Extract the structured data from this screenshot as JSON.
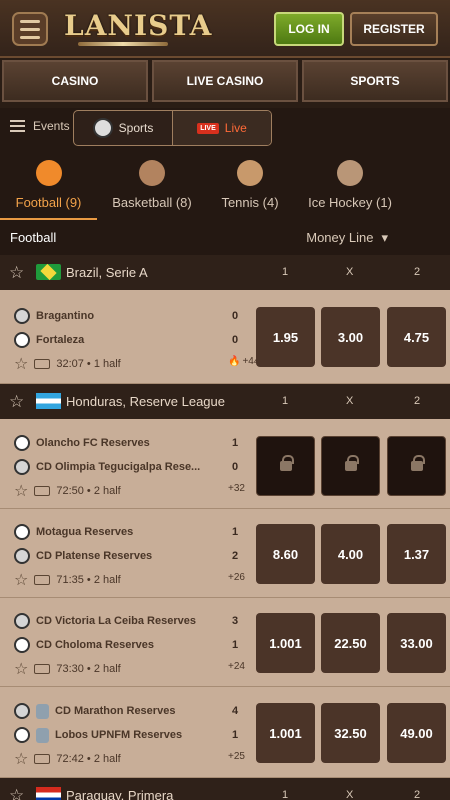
{
  "header": {
    "login_label": "LOG IN",
    "register_label": "REGISTER",
    "logo_text": "LANISTA"
  },
  "nav": {
    "tabs": [
      "CASINO",
      "LIVE CASINO",
      "SPORTS"
    ]
  },
  "subbar": {
    "events_label": "Events",
    "sports_label": "Sports",
    "live_label": "Live",
    "live_badge": "LIVE"
  },
  "sports": [
    {
      "label": "Football (9)",
      "icon": "football-icon"
    },
    {
      "label": "Basketball (8)",
      "icon": "basketball-icon"
    },
    {
      "label": "Tennis (4)",
      "icon": "tennis-icon"
    },
    {
      "label": "Ice Hockey (1)",
      "icon": "ice-hockey-icon"
    }
  ],
  "list": {
    "title": "Football",
    "market": "Money Line"
  },
  "leagues": [
    {
      "name": "Brazil, Serie A",
      "h1": "1",
      "hx": "X",
      "h2": "2"
    },
    {
      "name": "Honduras, Reserve League",
      "h1": "1",
      "hx": "X",
      "h2": "2"
    },
    {
      "name": "Paraguay, Primera",
      "h1": "1",
      "hx": "X",
      "h2": "2"
    }
  ],
  "matches": [
    {
      "team1": "Bragantino",
      "score1": "0",
      "team2": "Fortaleza",
      "score2": "0",
      "time": "32:07 • 1 half",
      "extra": "+442",
      "odds": [
        "1.95",
        "3.00",
        "4.75"
      ]
    },
    {
      "team1": "Olancho FC Reserves",
      "score1": "1",
      "team2": "CD Olimpia Tegucigalpa Rese...",
      "score2": "0",
      "time": "72:50 • 2 half",
      "extra": "+32",
      "odds": [
        "",
        "",
        ""
      ]
    },
    {
      "team1": "Motagua Reserves",
      "score1": "1",
      "team2": "CD Platense Reserves",
      "score2": "2",
      "time": "71:35 • 2 half",
      "extra": "+26",
      "odds": [
        "8.60",
        "4.00",
        "1.37"
      ]
    },
    {
      "team1": "CD Victoria La Ceiba Reserves",
      "score1": "3",
      "team2": "CD Choloma Reserves",
      "score2": "1",
      "time": "73:30 • 2 half",
      "extra": "+24",
      "odds": [
        "1.001",
        "22.50",
        "33.00"
      ]
    },
    {
      "team1": "CD Marathon Reserves",
      "score1": "4",
      "team2": "Lobos UPNFM Reserves",
      "score2": "1",
      "time": "72:42 • 2 half",
      "extra": "+25",
      "odds": [
        "1.001",
        "32.50",
        "49.00"
      ]
    }
  ],
  "colors": {
    "accent": "#e99a43",
    "login_green": "#6f9c22",
    "live_red": "#d8301d"
  }
}
